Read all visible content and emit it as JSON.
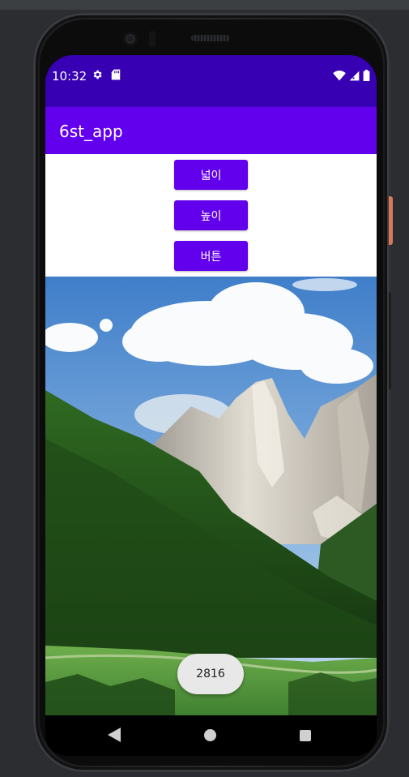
{
  "status_bar": {
    "time": "10:32",
    "icons_left": [
      "gear-icon",
      "sd-card-icon"
    ],
    "icons_right": [
      "wifi-icon",
      "signal-icon",
      "battery-icon"
    ]
  },
  "app_bar": {
    "title": "6st_app"
  },
  "buttons": {
    "width_label": "넓이",
    "height_label": "높이",
    "button_label": "버튼"
  },
  "image": {
    "description": "mountain-landscape"
  },
  "toast": {
    "text": "2816"
  },
  "nav_bar": {
    "icons": [
      "back-icon",
      "home-icon",
      "recents-icon"
    ]
  },
  "colors": {
    "status_bar": "#3700b3",
    "app_bar": "#6200ee",
    "button": "#6200ee",
    "toast_bg": "#e8e8e8"
  }
}
